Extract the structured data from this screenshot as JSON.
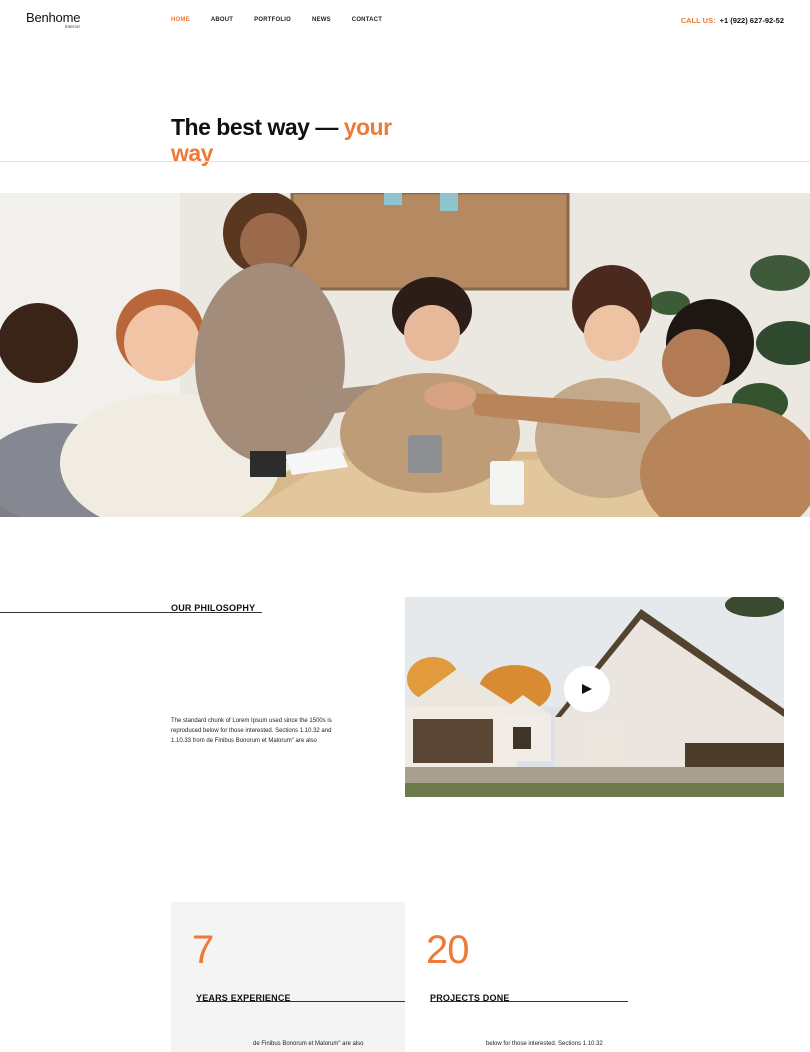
{
  "header": {
    "logo": "Benhome",
    "logo_sub": "Interior",
    "nav": [
      {
        "label": "HOME",
        "active": true
      },
      {
        "label": "ABOUT",
        "active": false
      },
      {
        "label": "PORTFOLIO",
        "active": false
      },
      {
        "label": "NEWS",
        "active": false
      },
      {
        "label": "CONTACT",
        "active": false
      }
    ],
    "call_label": "CALL US:",
    "phone": "+1 (922) 627-92-52"
  },
  "hero": {
    "title_main": "The best way — ",
    "title_accent": "your way"
  },
  "philosophy": {
    "title": "OUR PHILOSOPHY",
    "text": "The standard chunk of Lorem Ipsum used since the 1500s is reproduced below for those interested. Sections 1.10.32 and 1.10.33 from de Finibus Bonorum et Malorum\"  are also"
  },
  "stats": [
    {
      "value": "7",
      "label": "YEARS EXPERIENCE",
      "text": "de Finibus Bonorum et Malorum\"  are also"
    },
    {
      "value": "20",
      "label": "PROJECTS DONE",
      "text": "below for those interested. Sections 1.10.32"
    }
  ],
  "colors": {
    "accent": "#ee7a38",
    "text": "#111111"
  },
  "icons": {
    "play": "play-icon"
  }
}
